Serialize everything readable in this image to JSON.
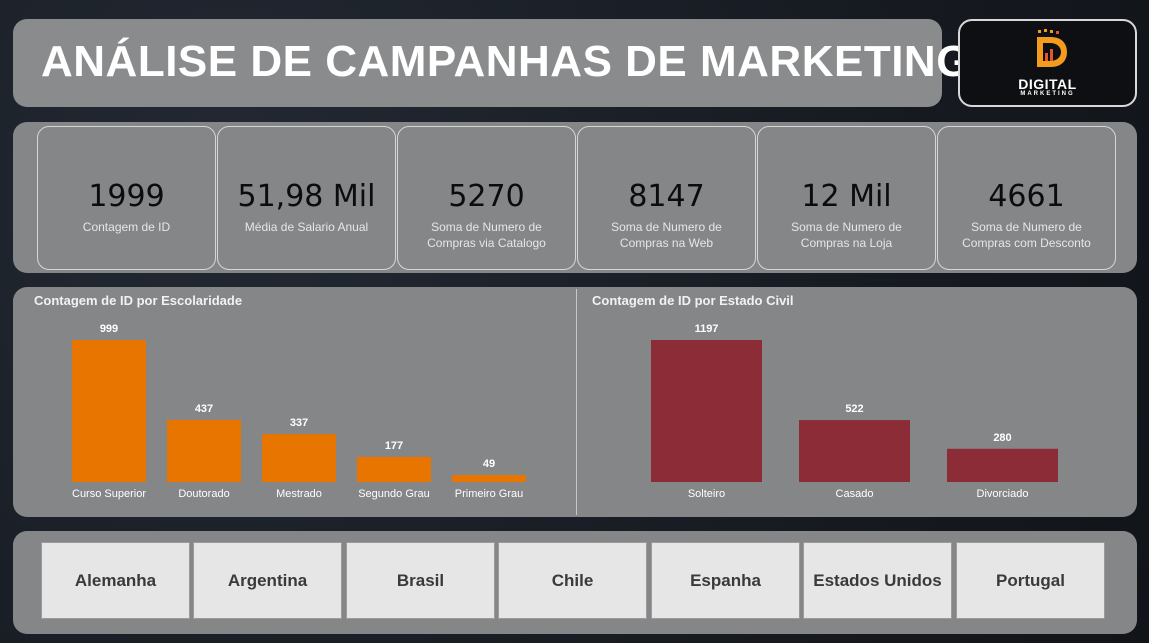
{
  "header": {
    "title": "ANÁLISE DE CAMPANHAS DE MARKETING"
  },
  "logo": {
    "text": "DIGITAL",
    "subtext": "MARKETING",
    "icon": "digital-marketing-logo-icon",
    "colors": {
      "accent": "#f29b1d",
      "accent2": "#e2572a"
    }
  },
  "kpis": [
    {
      "value": "1999",
      "label": "Contagem de ID"
    },
    {
      "value": "51,98 Mil",
      "label": "Média de Salario Anual"
    },
    {
      "value": "5270",
      "label": "Soma de Numero de Compras via Catalogo"
    },
    {
      "value": "8147",
      "label": "Soma de Numero de Compras na Web"
    },
    {
      "value": "12 Mil",
      "label": "Soma de Numero de Compras na Loja"
    },
    {
      "value": "4661",
      "label": "Soma de Numero de Compras com Desconto"
    }
  ],
  "chart_data": [
    {
      "type": "bar",
      "title": "Contagem de ID por Escolaridade",
      "categories": [
        "Curso Superior",
        "Doutorado",
        "Mestrado",
        "Segundo Grau",
        "Primeiro Grau"
      ],
      "values": [
        999,
        437,
        337,
        177,
        49
      ],
      "color": "#e87500",
      "xlabel": "",
      "ylabel": "",
      "grid": false
    },
    {
      "type": "bar",
      "title": "Contagem de ID por Estado Civil",
      "categories": [
        "Solteiro",
        "Casado",
        "Divorciado"
      ],
      "values": [
        1197,
        522,
        280
      ],
      "color": "#8b2c36",
      "xlabel": "",
      "ylabel": "",
      "grid": false
    }
  ],
  "filters": {
    "countries": [
      "Alemanha",
      "Argentina",
      "Brasil",
      "Chile",
      "Espanha",
      "Estados Unidos",
      "Portugal"
    ]
  }
}
